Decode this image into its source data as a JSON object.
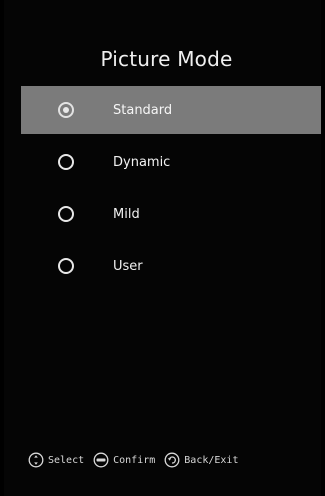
{
  "title": "Picture Mode",
  "options": [
    {
      "label": "Standard",
      "selected": true
    },
    {
      "label": "Dynamic",
      "selected": false
    },
    {
      "label": "Mild",
      "selected": false
    },
    {
      "label": "User",
      "selected": false
    }
  ],
  "footer": {
    "select_label": "Select",
    "confirm_label": "Confirm",
    "back_label": "Back/Exit",
    "select_icon": "dpad-icon",
    "confirm_icon": "enter-button-icon",
    "back_icon": "back-arrow-icon"
  },
  "colors": {
    "background": "#000000",
    "highlight": "#7b7b7b",
    "text": "#ffffff"
  }
}
